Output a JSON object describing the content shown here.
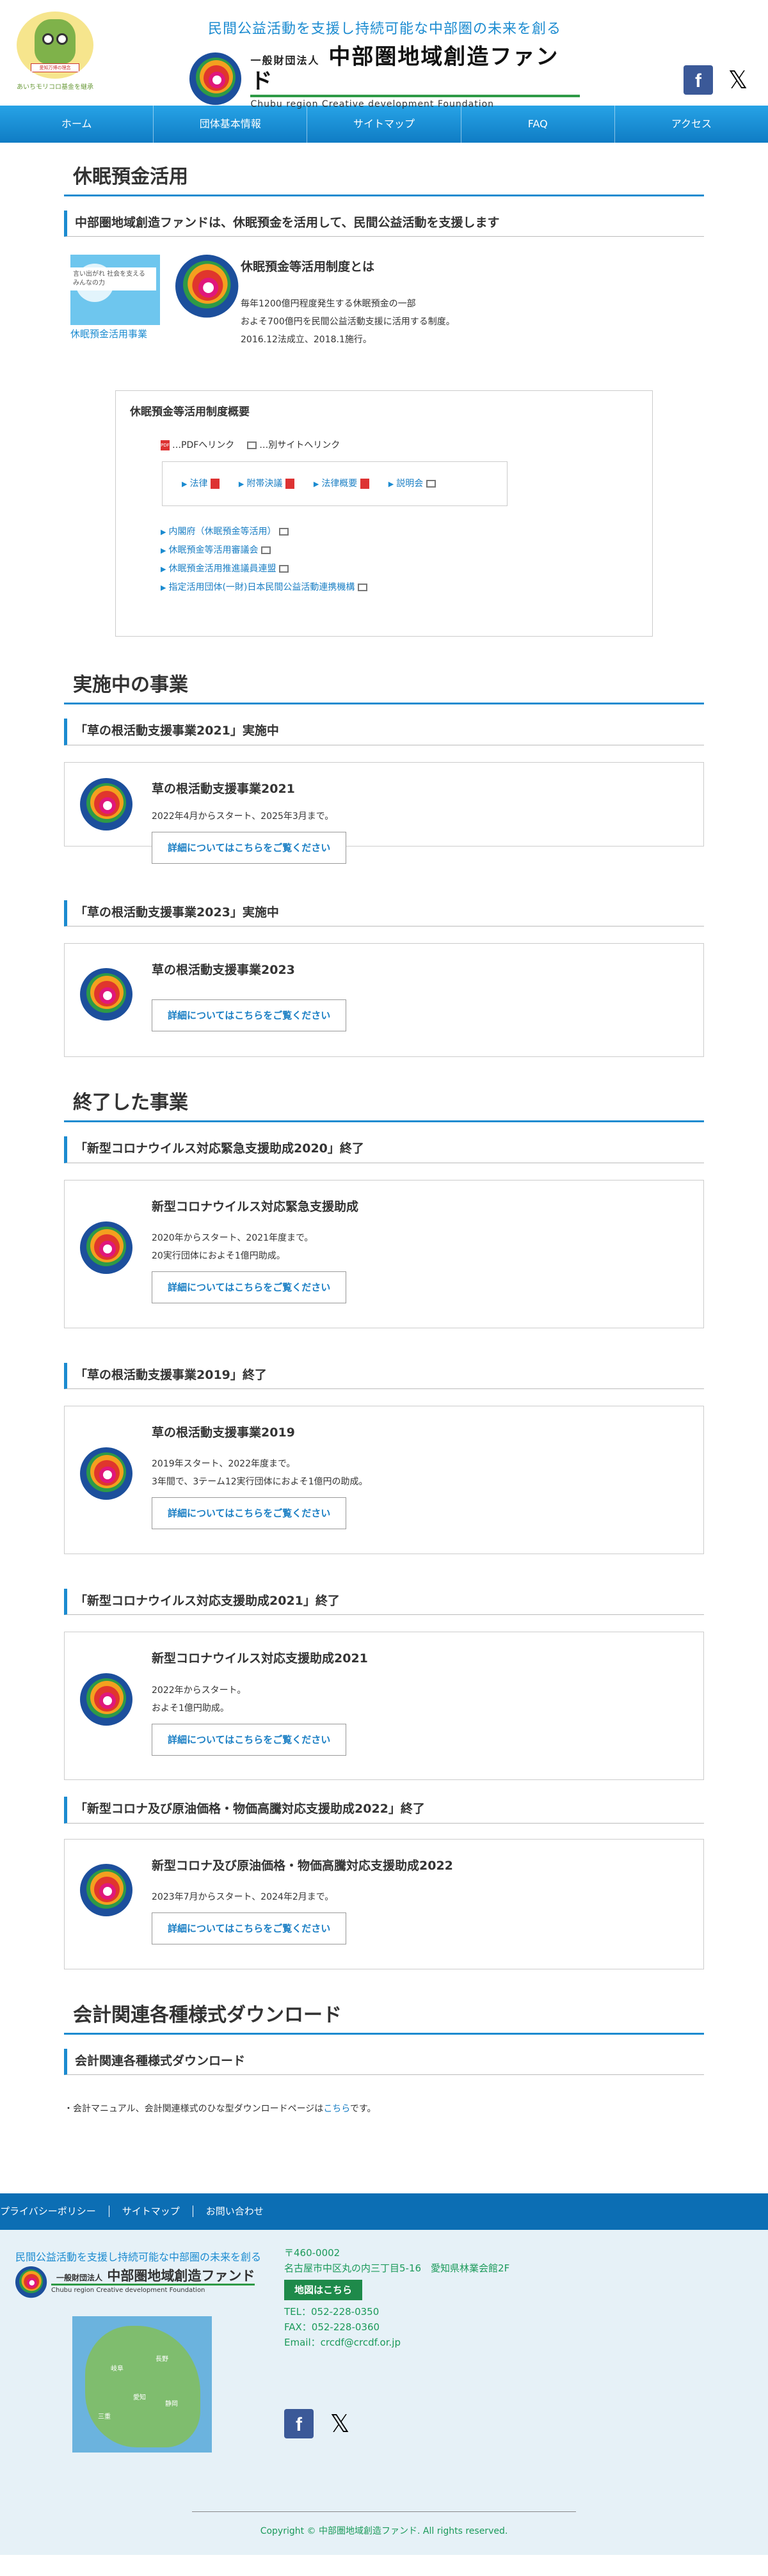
{
  "header": {
    "mascot_text": "あいちモリコロ基金を継承",
    "mascot_ribbon": "愛知万博の理念",
    "tagline": "民間公益活動を支援し持続可能な中部圏の未来を創る",
    "logo_prefix": "一般財団法人",
    "logo_name": "中部圏地域創造ファンド",
    "logo_en": "Chubu region Creative development Foundation",
    "social": {
      "facebook": "f",
      "x": "𝕏"
    }
  },
  "nav": [
    "ホーム",
    "団体基本情報",
    "サイトマップ",
    "FAQ",
    "アクセス"
  ],
  "kyumin": {
    "heading": "休眠預金活用",
    "subheading": "中部圏地域創造ファンドは、休眠預金を活用して、民間公益活動を支援します",
    "badge_text": "言い出がれ 社会を支える みんなの力",
    "badge_caption": "休眠預金活用事業",
    "intro_title": "休眠預金等活用制度とは",
    "intro_lines": [
      "毎年1200億円程度発生する休眠預金の一部",
      "およそ700億円を民間公益活動支援に活用する制度。",
      "2016.12法成立、2018.1施行。"
    ],
    "overview_title": "休眠預金等活用制度概要",
    "legend_pdf": "…PDFへリンク",
    "legend_ext": "…別サイトへリンク",
    "pdf_label": "PDF",
    "links": [
      "法律",
      "附帯決議",
      "法律概要",
      "説明会"
    ],
    "list": [
      "内閣府（休眠預金等活用）",
      "休眠預金等活用審議会",
      "休眠預金活用推進議員連盟",
      "指定活用団体(一財)日本民間公益活動連携機構"
    ]
  },
  "active": {
    "heading": "実施中の事業",
    "items": [
      {
        "sub": "「草の根活動支援事業2021」実施中",
        "title": "草の根活動支援事業2021",
        "desc": "2022年4月からスタート、2025年3月まで。",
        "button": "詳細についてはこちらをご覧ください"
      },
      {
        "sub": "「草の根活動支援事業2023」実施中",
        "title": "草の根活動支援事業2023",
        "desc": "",
        "button": "詳細についてはこちらをご覧ください"
      }
    ]
  },
  "ended": {
    "heading": "終了した事業",
    "items": [
      {
        "sub": "「新型コロナウイルス対応緊急支援助成2020」終了",
        "title": "新型コロナウイルス対応緊急支援助成",
        "desc": "2020年からスタート、2021年度まで。\n20実行団体におよそ1億円助成。",
        "button": "詳細についてはこちらをご覧ください"
      },
      {
        "sub": "「草の根活動支援事業2019」終了",
        "title": "草の根活動支援事業2019",
        "desc": "2019年スタート、2022年度まで。\n3年間で、3テーム12実行団体におよそ1億円の助成。",
        "button": "詳細についてはこちらをご覧ください"
      },
      {
        "sub": "「新型コロナウイルス対応支援助成2021」終了",
        "title": "新型コロナウイルス対応支援助成2021",
        "desc": "2022年からスタート。\nおよそ1億円助成。",
        "button": "詳細についてはこちらをご覧ください"
      },
      {
        "sub": "「新型コロナ及び原油価格・物価高騰対応支援助成2022」終了",
        "title": "新型コロナ及び原油価格・物価高騰対応支援助成2022",
        "desc": "2023年7月からスタート、2024年2月まで。",
        "button": "詳細についてはこちらをご覧ください"
      }
    ]
  },
  "download": {
    "heading": "会計関連各種様式ダウンロード",
    "sub": "会計関連各種様式ダウンロード",
    "text_before": "・会計マニュアル、会計関連様式のひな型ダウンロードページは",
    "link": "こちら",
    "text_after": "です。"
  },
  "footer": {
    "links": [
      "プライバシーポリシー",
      "サイトマップ",
      "お問い合わせ"
    ],
    "tagline": "民間公益活動を支援し持続可能な中部圏の未来を創る",
    "logo_prefix": "一般財団法人",
    "logo_name": "中部圏地域創造ファンド",
    "logo_en": "Chubu region Creative development Foundation",
    "map_labels": [
      "長野",
      "岐阜",
      "愛知",
      "静岡",
      "三重"
    ],
    "postal": "〒460-0002",
    "address": "名古屋市中区丸の内三丁目5-16　愛知県林業会館2F",
    "map_button": "地図はこちら",
    "tel": "TEL：052-228-0350",
    "fax": "FAX：052-228-0360",
    "email": "Email：crcdf@crcdf.or.jp",
    "copyright": "Copyright © 中部圏地域創造ファンド. All rights reserved."
  },
  "colors": {
    "accent": "#1b8bd0",
    "nav": "#1b8bd0",
    "footer_bar": "#0c6eb4",
    "footer_bg": "#e6f1f7",
    "green": "#2e9a46"
  }
}
